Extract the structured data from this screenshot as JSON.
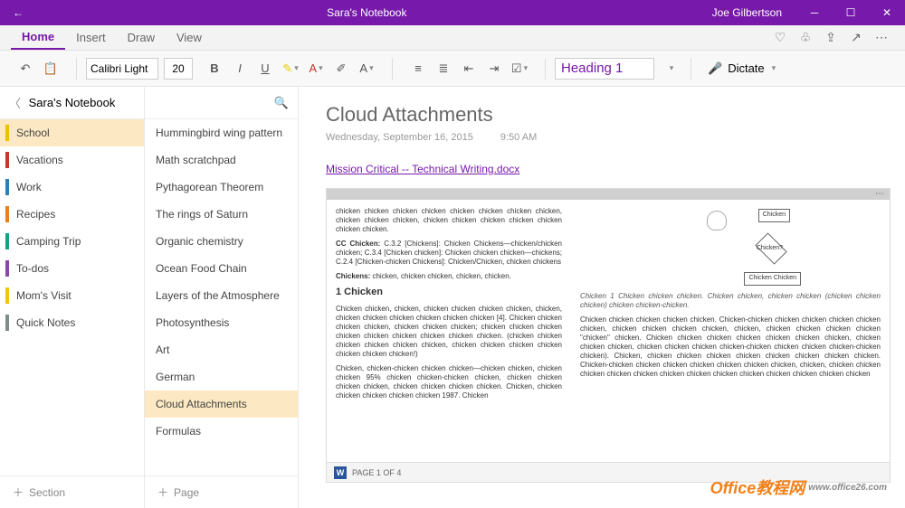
{
  "titlebar": {
    "title": "Sara's Notebook",
    "user": "Joe Gilbertson"
  },
  "tabs": {
    "home": "Home",
    "insert": "Insert",
    "draw": "Draw",
    "view": "View"
  },
  "toolbar": {
    "font": "Calibri Light",
    "size": "20",
    "heading": "Heading 1",
    "dictate": "Dictate"
  },
  "notebook": {
    "name": "Sara's Notebook",
    "sections": [
      "School",
      "Vacations",
      "Work",
      "Recipes",
      "Camping Trip",
      "To-dos",
      "Mom's Visit",
      "Quick Notes"
    ],
    "add_section": "Section",
    "pages": [
      "Hummingbird wing pattern",
      "Math scratchpad",
      "Pythagorean Theorem",
      "The rings of Saturn",
      "Organic chemistry",
      "Ocean Food Chain",
      "Layers of the Atmosphere",
      "Photosynthesis",
      "Art",
      "German",
      "Cloud Attachments",
      "Formulas"
    ],
    "add_page": "Page"
  },
  "page": {
    "title": "Cloud Attachments",
    "date": "Wednesday, September 16, 2015",
    "time": "9:50 AM",
    "link": "Mission Critical -- Technical Writing.docx"
  },
  "doc": {
    "para_top1": "chicken chicken chicken chicken chicken chicken chicken chicken, chicken chicken chicken, chicken chicken chicken chicken chicken chicken chicken.",
    "cc_label": "CC Chicken:",
    "cc_body": "C.3.2 [Chickens]: Chicken Chickens—chicken/chicken chicken; C.3.4 [Chicken chicken]: Chicken chicken chicken—chickens; C.2.4 [Chicken-chicken Chickens]: Chicken/Chicken, chicken chickens",
    "kw_label": "Chickens:",
    "kw_body": "chicken, chicken chicken, chicken, chicken.",
    "h1": "1   Chicken",
    "p1": "Chicken chicken, chicken, chicken chicken chicken chicken, chicken, chicken chicken chicken chicken chicken chicken [4]. Chicken chicken chicken chicken, chicken chicken chicken; chicken chicken chicken chicken chicken chicken chicken chicken chicken. (chicken chicken chicken chicken chicken chicken, chicken chicken chicken chicken chicken chicken chicken!)",
    "p2": "Chicken, chicken-chicken chicken chicken—chicken chicken, chicken chicken 95% chicken chicken-chicken chicken, chicken chicken chicken chicken, chicken chicken chicken chicken. Chicken, chicken chicken chicken chicken chicken 1987. Chicken",
    "dg_label1": "Chicken",
    "dg_label2": "Chicken?",
    "dg_label3": "Chicken Chicken",
    "figcap": "Chicken 1  Chicken chicken chicken. Chicken chicken, chicken chicken (chicken chicken chicken) chicken chicken-chicken.",
    "rp1": "Chicken chicken chicken chicken chicken. Chicken-chicken chicken chicken chicken chicken chicken, chicken chicken chicken chicken, chicken, chicken chicken chicken chicken \"chicken\" chicken. Chicken chicken chicken chicken chicken chicken chicken, chicken chicken chicken, chicken chicken chicken chicken-chicken chicken chicken chicken-chicken chicken). Chicken, chicken chicken chicken chicken chicken chicken chicken chicken. Chicken-chicken chicken chicken chicken chicken chicken chicken, chicken, chicken chicken chicken chicken chicken chicken chicken chicken chicken chicken chicken chicken chicken",
    "status": "PAGE 1 OF 4"
  },
  "watermark": {
    "brand": "Office教程网",
    "url": "www.office26.com"
  }
}
